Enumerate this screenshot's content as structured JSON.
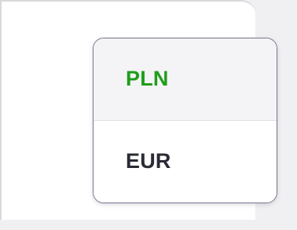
{
  "currency_dropdown": {
    "options": [
      {
        "label": "PLN",
        "selected": true
      },
      {
        "label": "EUR",
        "selected": false
      }
    ],
    "selected_color": "#1e9e1a",
    "text_color": "#2b2b36"
  }
}
